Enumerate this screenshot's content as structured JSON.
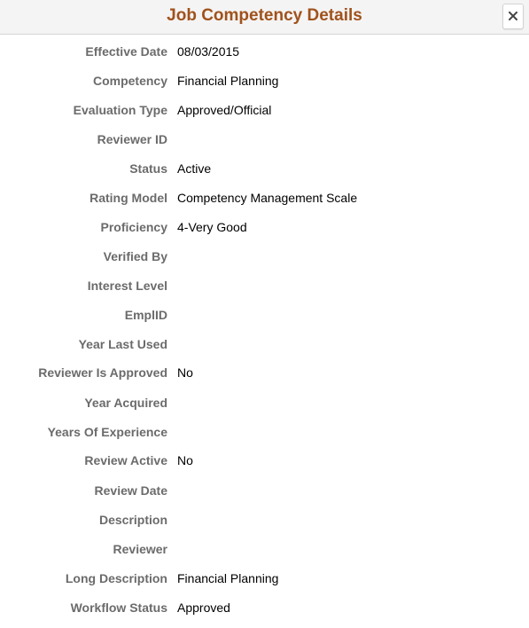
{
  "header": {
    "title": "Job Competency Details",
    "close_icon": "close-x-icon"
  },
  "colors": {
    "title": "#a0521c",
    "label": "#6b6b6b",
    "value": "#000000",
    "header_bg": "#f4f4f4"
  },
  "fields": [
    {
      "label": "Effective Date",
      "value": "08/03/2015"
    },
    {
      "label": "Competency",
      "value": "Financial Planning"
    },
    {
      "label": "Evaluation Type",
      "value": "Approved/Official"
    },
    {
      "label": "Reviewer ID",
      "value": ""
    },
    {
      "label": "Status",
      "value": "Active"
    },
    {
      "label": "Rating Model",
      "value": "Competency Management Scale"
    },
    {
      "label": "Proficiency",
      "value": "4-Very Good"
    },
    {
      "label": "Verified By",
      "value": ""
    },
    {
      "label": "Interest Level",
      "value": ""
    },
    {
      "label": "EmplID",
      "value": ""
    },
    {
      "label": "Year Last Used",
      "value": ""
    },
    {
      "label": "Reviewer Is Approved",
      "value": "No"
    },
    {
      "label": "Year Acquired",
      "value": ""
    },
    {
      "label": "Years Of Experience",
      "value": ""
    },
    {
      "label": "Review Active",
      "value": "No"
    },
    {
      "label": "Review Date",
      "value": ""
    },
    {
      "label": "Description",
      "value": ""
    },
    {
      "label": "Reviewer",
      "value": ""
    },
    {
      "label": "Long Description",
      "value": "Financial Planning"
    },
    {
      "label": "Workflow Status",
      "value": "Approved"
    }
  ]
}
